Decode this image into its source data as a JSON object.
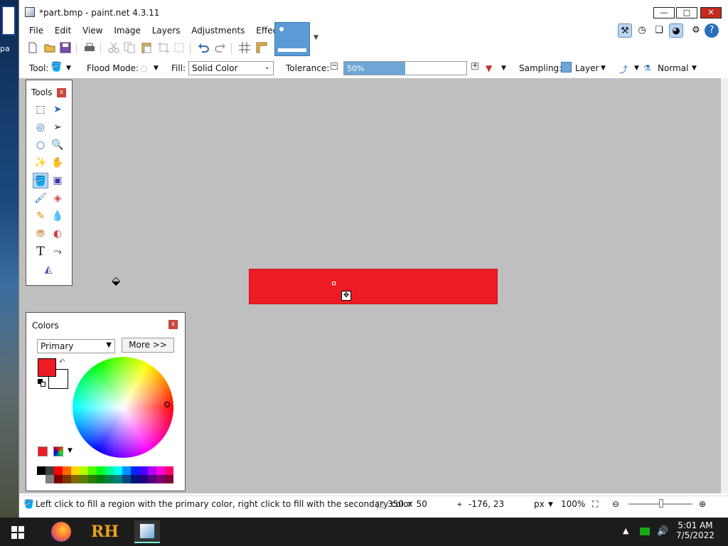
{
  "desktop": {
    "icon_label": "pa"
  },
  "window": {
    "title": "*part.bmp - paint.net 4.3.11",
    "minimize": "—",
    "maximize": "□",
    "close": "✕"
  },
  "menu": [
    "File",
    "Edit",
    "View",
    "Image",
    "Layers",
    "Adjustments",
    "Effects"
  ],
  "toolbar2": {
    "tool_label": "Tool:",
    "flood_mode_label": "Flood Mode:",
    "fill_label": "Fill:",
    "fill_value": "Solid Color",
    "tolerance_label": "Tolerance:",
    "tolerance_value": "50%",
    "tolerance_fraction": 0.5,
    "sampling_label": "Sampling:",
    "sampling_value": "Layer",
    "blend_value": "Normal"
  },
  "tools_panel": {
    "title": "Tools",
    "close": "x"
  },
  "colors_panel": {
    "title": "Colors",
    "close": "x",
    "mode_value": "Primary",
    "more_label": "More >>",
    "primary_color": "#ed1c24",
    "secondary_color": "#ffffff"
  },
  "palette": [
    "#000000",
    "#404040",
    "#ff0000",
    "#ff6a00",
    "#ffd800",
    "#b6ff00",
    "#4cff00",
    "#00ff21",
    "#00ff90",
    "#00ffff",
    "#0094ff",
    "#0026ff",
    "#4800ff",
    "#b200ff",
    "#ff00dc",
    "#ff006e",
    "#ffffff",
    "#808080",
    "#7f0000",
    "#7f3300",
    "#7f6a00",
    "#5b7f00",
    "#267f00",
    "#007f0e",
    "#007f46",
    "#007f7f",
    "#004a7f",
    "#00137f",
    "#21007f",
    "#57007f",
    "#7f006e",
    "#7f0037"
  ],
  "status": {
    "hint": "Left click to fill a region with the primary color, right click to fill with the secondary color",
    "size": "350 × 50",
    "position": "-176, 23",
    "units": "px",
    "zoom": "100%"
  },
  "taskbar": {
    "time": "5:01 AM",
    "date": "7/5/2022",
    "rh_label": "RH"
  },
  "colors": {
    "accent": "#5b9bd5",
    "canvas_bg": "#bfbfbf",
    "shape_fill": "#ed1c24"
  }
}
